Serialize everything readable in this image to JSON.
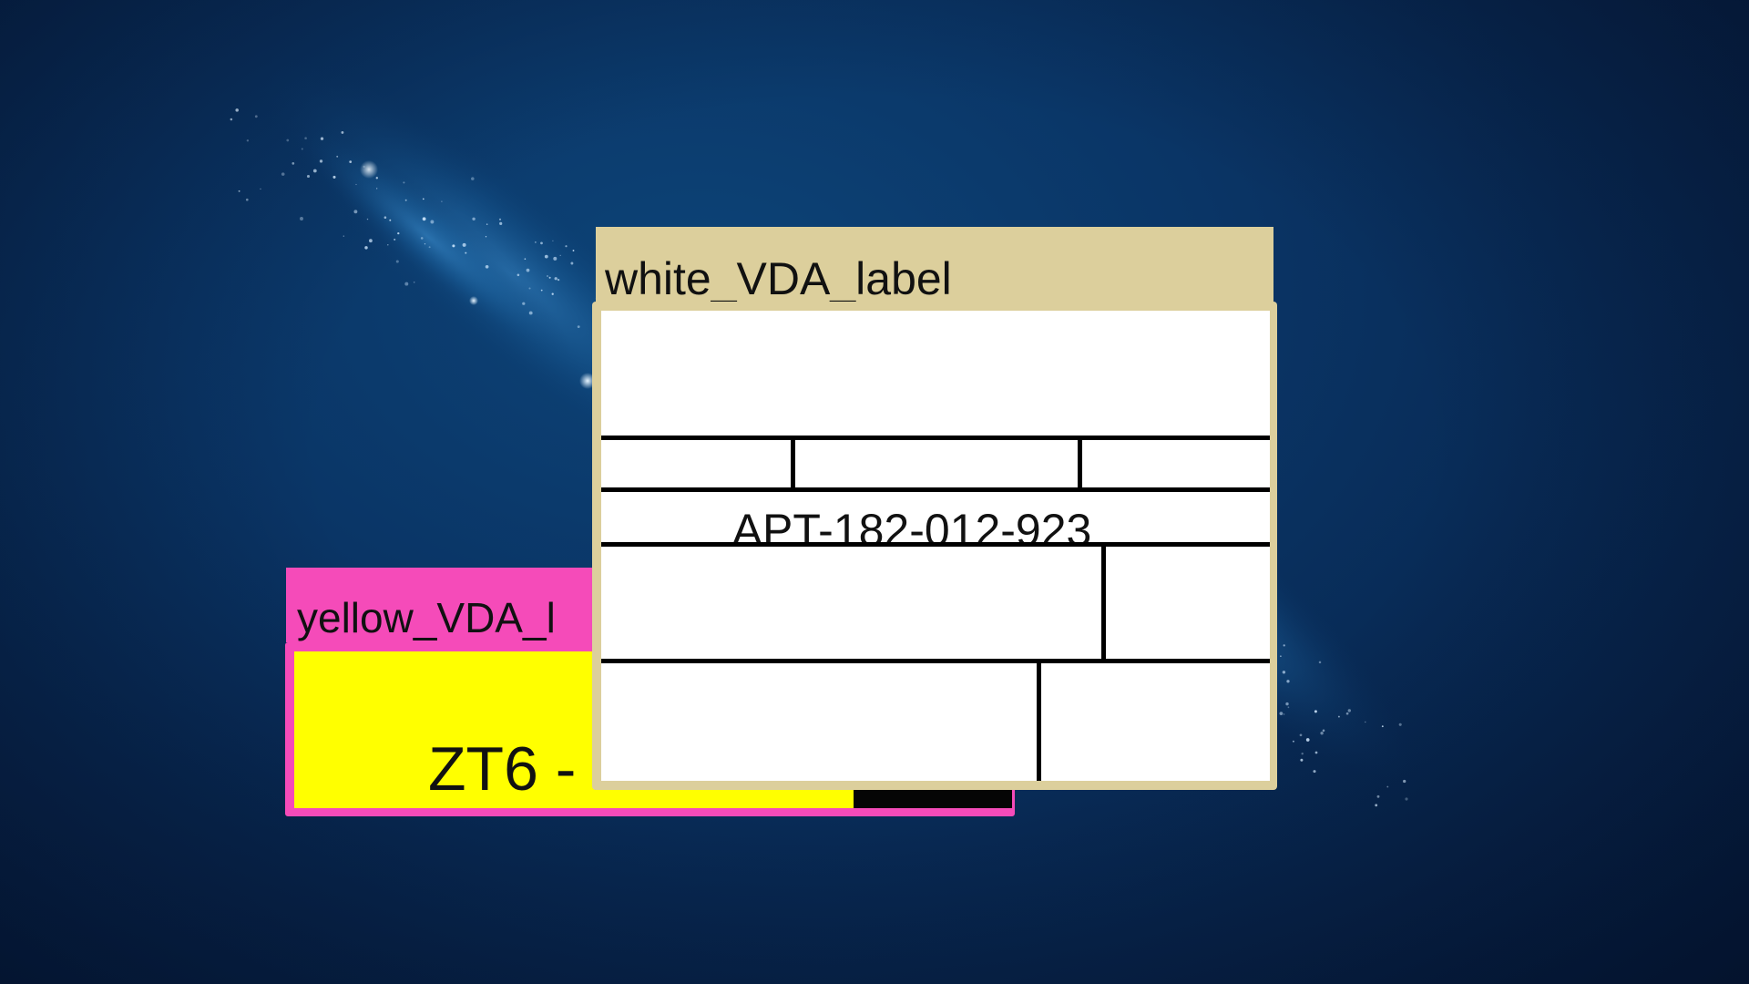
{
  "desktop": {
    "wallpaper": "blue-nebula-starfield",
    "colors": {
      "background": "#0a3566",
      "nebula": "#2f7fc0",
      "stars": "#cfe8ff"
    }
  },
  "windows": {
    "yellow": {
      "title": "yellow_VDA_l",
      "model_text": "ZT6 - Z…",
      "colors": {
        "frame": "#f54bb9",
        "label": "#ffff00",
        "block": "#050505"
      }
    },
    "white": {
      "title": "white_VDA_label",
      "serial": "APT-182-012-923",
      "colors": {
        "frame": "#dccf9c",
        "label": "#ffffff",
        "lines": "#000000"
      }
    }
  }
}
